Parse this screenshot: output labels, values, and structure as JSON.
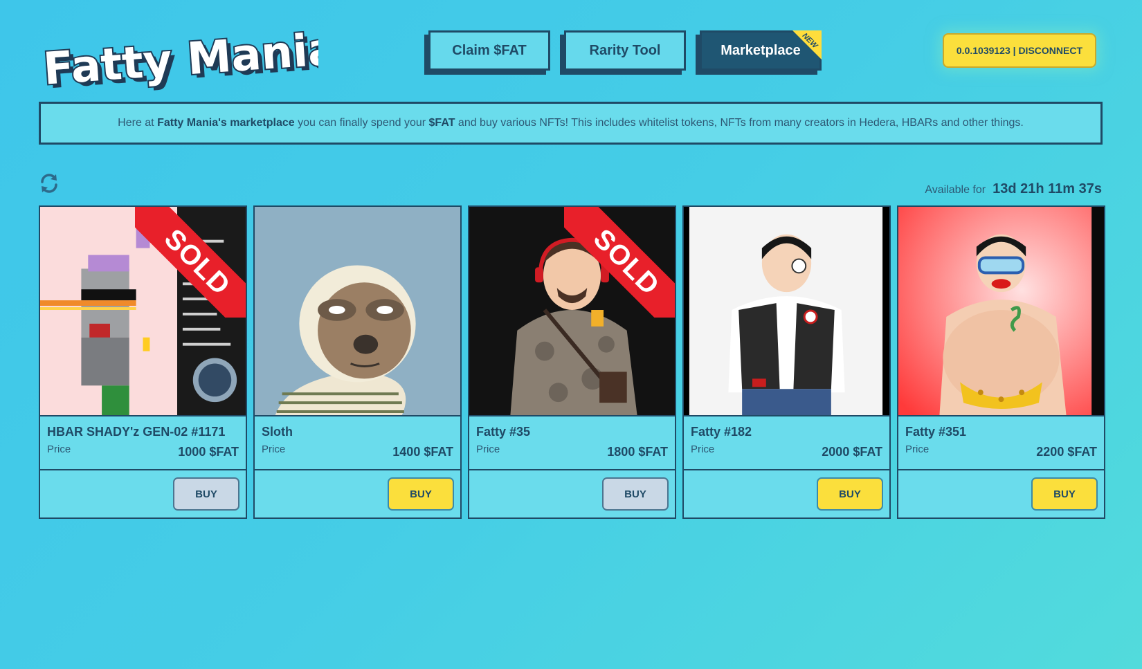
{
  "logo": {
    "text": "Fatty Mania"
  },
  "nav": {
    "tabs": [
      {
        "label": "Claim $FAT",
        "active": false
      },
      {
        "label": "Rarity Tool",
        "active": false
      },
      {
        "label": "Marketplace",
        "active": true,
        "badge": "NEW"
      }
    ]
  },
  "wallet": {
    "label": "0.0.1039123 | DISCONNECT"
  },
  "banner": {
    "part1": "Here at ",
    "bold1": "Fatty Mania's marketplace",
    "part2": " you can finally spend your ",
    "bold2": "$FAT",
    "part3": " and buy various NFTs! This includes whitelist tokens, NFTs from many creators in Hedera, HBARs and other things."
  },
  "toolbar": {
    "refresh_icon": "refresh-icon",
    "available_label": "Available for",
    "countdown": "13d 21h 11m 37s"
  },
  "items": [
    {
      "name": "HBAR SHADY'z GEN-02 #1171",
      "price_label": "Price",
      "price": "1000 $FAT",
      "buy_label": "BUY",
      "sold": true,
      "sold_label": "SOLD",
      "image": "pixel-character"
    },
    {
      "name": "Sloth",
      "price_label": "Price",
      "price": "1400 $FAT",
      "buy_label": "BUY",
      "sold": false,
      "image": "sloth"
    },
    {
      "name": "Fatty #35",
      "price_label": "Price",
      "price": "1800 $FAT",
      "buy_label": "BUY",
      "sold": true,
      "sold_label": "SOLD",
      "image": "fatty-hoodie"
    },
    {
      "name": "Fatty #182",
      "price_label": "Price",
      "price": "2000 $FAT",
      "buy_label": "BUY",
      "sold": false,
      "image": "fatty-vest"
    },
    {
      "name": "Fatty #351",
      "price_label": "Price",
      "price": "2200 $FAT",
      "buy_label": "BUY",
      "sold": false,
      "image": "fatty-swim"
    }
  ],
  "colors": {
    "accent": "#fbdf3c",
    "dark": "#1f4a66",
    "panel": "#6adcec",
    "sold": "#e8202a"
  }
}
